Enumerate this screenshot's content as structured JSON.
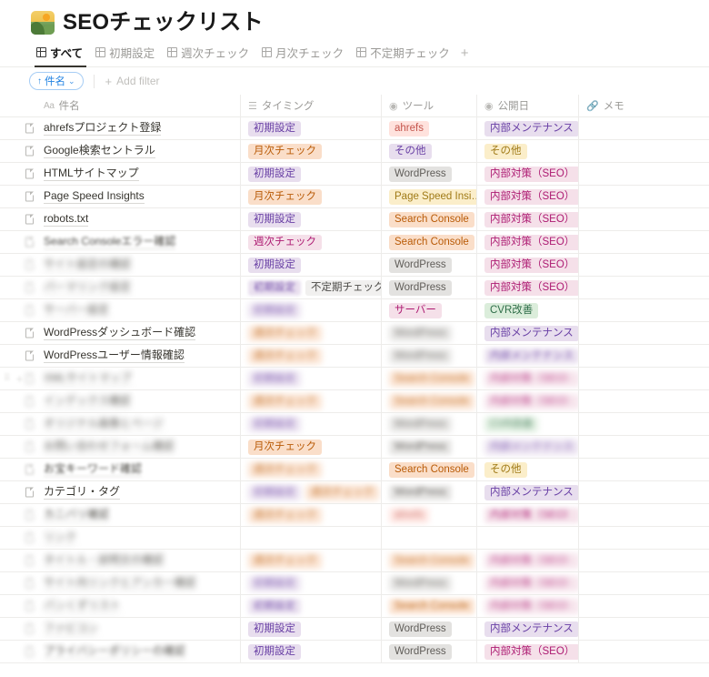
{
  "header": {
    "title": "SEOチェックリスト",
    "icon": "mountain-sunrise-icon"
  },
  "tabs": {
    "items": [
      {
        "label": "すべて",
        "icon": "grid-icon",
        "active": true
      },
      {
        "label": "初期設定",
        "icon": "grid-icon",
        "active": false
      },
      {
        "label": "週次チェック",
        "icon": "grid-icon",
        "active": false
      },
      {
        "label": "月次チェック",
        "icon": "grid-icon",
        "active": false
      },
      {
        "label": "不定期チェック",
        "icon": "grid-icon",
        "active": false
      }
    ],
    "add_label": "+"
  },
  "toolbar": {
    "sort_label": "件名",
    "sort_direction_icon": "arrow-up-icon",
    "sort_caret_icon": "chevron-down-icon",
    "add_filter_label": "Add filter",
    "add_filter_icon": "plus-icon",
    "accent_color": "#2383e2"
  },
  "table": {
    "columns": [
      {
        "key": "title",
        "label": "件名",
        "icon": "aa-text-icon"
      },
      {
        "key": "timing",
        "label": "タイミング",
        "icon": "multi-select-icon"
      },
      {
        "key": "tool",
        "label": "ツール",
        "icon": "select-icon"
      },
      {
        "key": "date",
        "label": "公開日",
        "icon": "select-icon"
      },
      {
        "key": "memo",
        "label": "メモ",
        "icon": "link-icon"
      }
    ],
    "rows": [
      {
        "title": "ahrefsプロジェクト登録",
        "blur": 0,
        "timing": [
          {
            "text": "初期設定",
            "color": "purple",
            "blur": 0
          }
        ],
        "tool": [
          {
            "text": "ahrefs",
            "color": "red",
            "blur": 0
          }
        ],
        "date": [
          {
            "text": "内部メンテナンス",
            "color": "purple",
            "blur": 0
          }
        ]
      },
      {
        "title": "Google検索セントラル",
        "blur": 0,
        "timing": [
          {
            "text": "月次チェック",
            "color": "orange",
            "blur": 0
          }
        ],
        "tool": [
          {
            "text": "その他",
            "color": "purple",
            "blur": 0
          }
        ],
        "date": [
          {
            "text": "その他",
            "color": "yellow",
            "blur": 0
          }
        ]
      },
      {
        "title": "HTMLサイトマップ",
        "blur": 0,
        "timing": [
          {
            "text": "初期設定",
            "color": "purple",
            "blur": 0
          }
        ],
        "tool": [
          {
            "text": "WordPress",
            "color": "gray",
            "blur": 0
          }
        ],
        "date": [
          {
            "text": "内部対策（SEO）",
            "color": "pink",
            "blur": 0
          }
        ]
      },
      {
        "title": "Page Speed Insights",
        "blur": 0,
        "timing": [
          {
            "text": "月次チェック",
            "color": "orange",
            "blur": 0
          }
        ],
        "tool": [
          {
            "text": "Page Speed Insi…",
            "color": "yellow",
            "blur": 0
          }
        ],
        "date": [
          {
            "text": "内部対策（SEO）",
            "color": "pink",
            "blur": 0
          }
        ]
      },
      {
        "title": "robots.txt",
        "blur": 0,
        "timing": [
          {
            "text": "初期設定",
            "color": "purple",
            "blur": 0
          }
        ],
        "tool": [
          {
            "text": "Search Console",
            "color": "orange",
            "blur": 0
          }
        ],
        "date": [
          {
            "text": "内部対策（SEO）",
            "color": "pink",
            "blur": 0
          }
        ]
      },
      {
        "title": "Search Consoleエラー確認",
        "blur": 1,
        "timing": [
          {
            "text": "週次チェック",
            "color": "pink",
            "blur": 0
          }
        ],
        "tool": [
          {
            "text": "Search Console",
            "color": "orange",
            "blur": 0
          }
        ],
        "date": [
          {
            "text": "内部対策（SEO）",
            "color": "pink",
            "blur": 0
          }
        ]
      },
      {
        "title": "サイト設定の確認",
        "blur": 3,
        "timing": [
          {
            "text": "初期設定",
            "color": "purple",
            "blur": 0
          }
        ],
        "tool": [
          {
            "text": "WordPress",
            "color": "gray",
            "blur": 0
          }
        ],
        "date": [
          {
            "text": "内部対策（SEO）",
            "color": "pink",
            "blur": 0
          }
        ]
      },
      {
        "title": "パーマリンク設定",
        "blur": 3,
        "timing": [
          {
            "text": "初期設定",
            "color": "purple",
            "blur": 1
          },
          {
            "text": "不定期チェック",
            "color": "default",
            "blur": 0
          }
        ],
        "tool": [
          {
            "text": "WordPress",
            "color": "gray",
            "blur": 0
          }
        ],
        "date": [
          {
            "text": "内部対策（SEO）",
            "color": "pink",
            "blur": 0
          }
        ]
      },
      {
        "title": "サーバー設定",
        "blur": 3,
        "timing": [
          {
            "text": "初期設定",
            "color": "purple",
            "blur": 3
          }
        ],
        "tool": [
          {
            "text": "サーバー",
            "color": "pink",
            "blur": 0
          }
        ],
        "date": [
          {
            "text": "CVR改善",
            "color": "green",
            "blur": 0
          }
        ]
      },
      {
        "title": "WordPressダッシュボード確認",
        "blur": 0,
        "timing": [
          {
            "text": "週次チェック",
            "color": "orange",
            "blur": 3
          }
        ],
        "tool": [
          {
            "text": "WordPress",
            "color": "gray",
            "blur": 3
          }
        ],
        "date": [
          {
            "text": "内部メンテナンス",
            "color": "purple",
            "blur": 0
          }
        ]
      },
      {
        "title": "WordPressユーザー情報確認",
        "blur": 0,
        "timing": [
          {
            "text": "週次チェック",
            "color": "orange",
            "blur": 3
          }
        ],
        "tool": [
          {
            "text": "WordPress",
            "color": "gray",
            "blur": 3
          }
        ],
        "date": [
          {
            "text": "内部メンテナンス",
            "color": "purple",
            "blur": 2
          }
        ]
      },
      {
        "title": "XMLサイトマップ",
        "blur": 3,
        "timing": [
          {
            "text": "初期設定",
            "color": "purple",
            "blur": 3
          }
        ],
        "tool": [
          {
            "text": "Search Console",
            "color": "orange",
            "blur": 3
          }
        ],
        "date": [
          {
            "text": "内部対策（SEO）",
            "color": "pink",
            "blur": 3
          }
        ]
      },
      {
        "title": "インデックス確認",
        "blur": 3,
        "timing": [
          {
            "text": "週次チェック",
            "color": "orange",
            "blur": 3
          }
        ],
        "tool": [
          {
            "text": "Search Console",
            "color": "orange",
            "blur": 3
          }
        ],
        "date": [
          {
            "text": "内部対策（SEO）",
            "color": "pink",
            "blur": 3
          }
        ]
      },
      {
        "title": "オリジナル画像とページ",
        "blur": 3,
        "timing": [
          {
            "text": "初期設定",
            "color": "purple",
            "blur": 3
          }
        ],
        "tool": [
          {
            "text": "WordPress",
            "color": "gray",
            "blur": 3
          }
        ],
        "date": [
          {
            "text": "CVR改善",
            "color": "green",
            "blur": 3
          }
        ]
      },
      {
        "title": "お問い合わせフォーム確認",
        "blur": 3,
        "timing": [
          {
            "text": "月次チェック",
            "color": "orange",
            "blur": 0
          }
        ],
        "tool": [
          {
            "text": "WordPress",
            "color": "gray",
            "blur": 2
          }
        ],
        "date": [
          {
            "text": "内部メンテナンス",
            "color": "purple",
            "blur": 3
          }
        ]
      },
      {
        "title": "お宝キーワード確認",
        "blur": 1,
        "timing": [
          {
            "text": "週次チェック",
            "color": "orange",
            "blur": 3
          }
        ],
        "tool": [
          {
            "text": "Search Console",
            "color": "orange",
            "blur": 0
          }
        ],
        "date": [
          {
            "text": "その他",
            "color": "yellow",
            "blur": 0
          }
        ]
      },
      {
        "title": "カテゴリ・タグ",
        "blur": 0,
        "timing": [
          {
            "text": "初期設定",
            "color": "purple",
            "blur": 3
          },
          {
            "text": "週次チェック",
            "color": "orange",
            "blur": 3
          }
        ],
        "tool": [
          {
            "text": "WordPress",
            "color": "gray",
            "blur": 2
          }
        ],
        "date": [
          {
            "text": "内部メンテナンス",
            "color": "purple",
            "blur": 0
          }
        ]
      },
      {
        "title": "カニバリ確認",
        "blur": 2,
        "timing": [
          {
            "text": "週次チェック",
            "color": "orange",
            "blur": 3
          }
        ],
        "tool": [
          {
            "text": "ahrefs",
            "color": "red",
            "blur": 3
          }
        ],
        "date": [
          {
            "text": "内部対策（SEO）",
            "color": "pink",
            "blur": 2
          }
        ]
      },
      {
        "title": "リンク",
        "blur": 3,
        "timing": [],
        "tool": [],
        "date": []
      },
      {
        "title": "タイトル・説明文の確認",
        "blur": 3,
        "timing": [
          {
            "text": "週次チェック",
            "color": "orange",
            "blur": 3
          }
        ],
        "tool": [
          {
            "text": "Search Console",
            "color": "orange",
            "blur": 3
          }
        ],
        "date": [
          {
            "text": "内部対策（SEO）",
            "color": "pink",
            "blur": 3
          }
        ]
      },
      {
        "title": "サイト内リンクとアンカー確認",
        "blur": 3,
        "timing": [
          {
            "text": "初期設定",
            "color": "purple",
            "blur": 3
          }
        ],
        "tool": [
          {
            "text": "WordPress",
            "color": "gray",
            "blur": 3
          }
        ],
        "date": [
          {
            "text": "内部対策（SEO）",
            "color": "pink",
            "blur": 3
          }
        ]
      },
      {
        "title": "パンくずリスト",
        "blur": 3,
        "timing": [
          {
            "text": "初期設定",
            "color": "purple",
            "blur": 2
          }
        ],
        "tool": [
          {
            "text": "Search Console",
            "color": "orange",
            "blur": 2
          }
        ],
        "date": [
          {
            "text": "内部対策（SEO）",
            "color": "pink",
            "blur": 3
          }
        ]
      },
      {
        "title": "ファビコン",
        "blur": 3,
        "timing": [
          {
            "text": "初期設定",
            "color": "purple",
            "blur": 0
          }
        ],
        "tool": [
          {
            "text": "WordPress",
            "color": "gray",
            "blur": 0
          }
        ],
        "date": [
          {
            "text": "内部メンテナンス",
            "color": "purple",
            "blur": 0
          }
        ]
      },
      {
        "title": "プライバシーポリシーの確認",
        "blur": 2,
        "timing": [
          {
            "text": "初期設定",
            "color": "purple",
            "blur": 0
          }
        ],
        "tool": [
          {
            "text": "WordPress",
            "color": "gray",
            "blur": 0
          }
        ],
        "date": [
          {
            "text": "内部対策（SEO）",
            "color": "pink",
            "blur": 0
          }
        ]
      }
    ]
  }
}
